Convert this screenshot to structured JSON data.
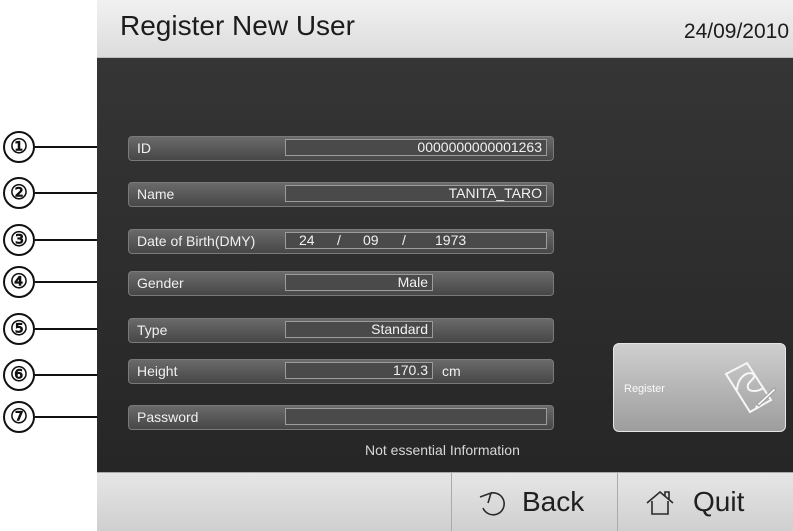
{
  "header": {
    "title": "Register New User",
    "date": "24/09/2010"
  },
  "callouts": [
    "①",
    "②",
    "③",
    "④",
    "⑤",
    "⑥",
    "⑦"
  ],
  "form": {
    "id": {
      "label": "ID",
      "value": "0000000000001263"
    },
    "name": {
      "label": "Name",
      "value": "TANITA_TARO"
    },
    "dob": {
      "label": "Date of Birth(DMY)",
      "day": "24",
      "month": "09",
      "year": "1973",
      "separator": "/"
    },
    "gender": {
      "label": "Gender",
      "value": "Male"
    },
    "type": {
      "label": "Type",
      "value": "Standard"
    },
    "height": {
      "label": "Height",
      "value": "170.3",
      "unit": "cm"
    },
    "password": {
      "label": "Password",
      "value": ""
    },
    "note": "Not essential Information"
  },
  "actions": {
    "register_label": "Register",
    "back_label": "Back",
    "quit_label": "Quit"
  },
  "icons": {
    "register": "signature-pen-icon",
    "back": "back-arrow-icon",
    "quit": "home-icon"
  }
}
